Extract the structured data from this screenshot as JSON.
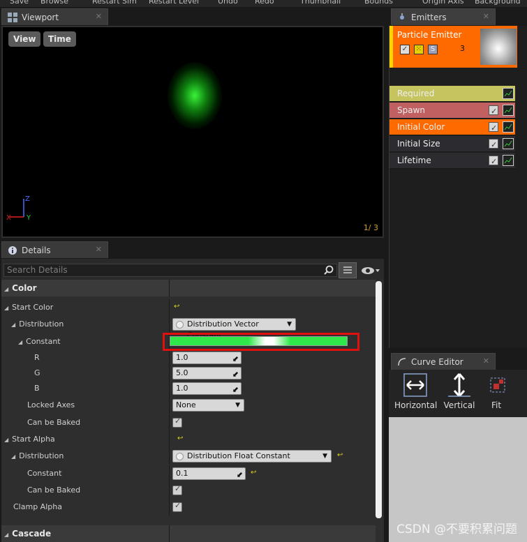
{
  "toolbar": {
    "items": [
      "Save",
      "Browse",
      "Restart Sim",
      "Restart Level",
      "Undo",
      "Redo",
      "Thumbnail",
      "Bounds",
      "Origin Axis",
      "Background"
    ]
  },
  "viewport": {
    "tab_label": "Viewport",
    "view_button": "View",
    "time_button": "Time",
    "frame_counter": "1/  3",
    "axis_x": "X",
    "axis_y": "Y",
    "axis_z": "Z"
  },
  "emitters": {
    "tab_label": "Emitters",
    "emitter_name": "Particle Emitter",
    "solo_label": "S",
    "particle_count": "3",
    "modules": [
      {
        "label": "Required",
        "color": "#c5c45f"
      },
      {
        "label": "Spawn",
        "color": "#c06060"
      },
      {
        "label": "Initial Color",
        "color": "#ff6a00"
      },
      {
        "label": "Initial Size",
        "color": "#2c2c30"
      },
      {
        "label": "Lifetime",
        "color": "#2c2c30"
      }
    ]
  },
  "curve_editor": {
    "tab_label": "Curve Editor",
    "tools": [
      "Horizontal",
      "Vertical",
      "Fit"
    ]
  },
  "details": {
    "tab_label": "Details",
    "search_placeholder": "Search Details",
    "categories": {
      "color": "Color",
      "cascade": "Cascade"
    },
    "rows": {
      "start_color": "Start Color",
      "distribution": "Distribution",
      "distribution_value": "Distribution Vector Constant",
      "constant": "Constant",
      "r_label": "R",
      "r_value": "1.0",
      "g_label": "G",
      "g_value": "5.0",
      "b_label": "B",
      "b_value": "1.0",
      "locked_axes": "Locked Axes",
      "locked_axes_value": "None",
      "can_be_baked": "Can be Baked",
      "start_alpha": "Start Alpha",
      "alpha_distribution": "Distribution",
      "alpha_distribution_value": "Distribution Float Constant",
      "alpha_constant": "Constant",
      "alpha_constant_value": "0.1",
      "alpha_can_be_baked": "Can be Baked",
      "clamp_alpha": "Clamp Alpha"
    },
    "constant_color": "#2fe84a"
  },
  "watermark": "CSDN @不要积累问题"
}
